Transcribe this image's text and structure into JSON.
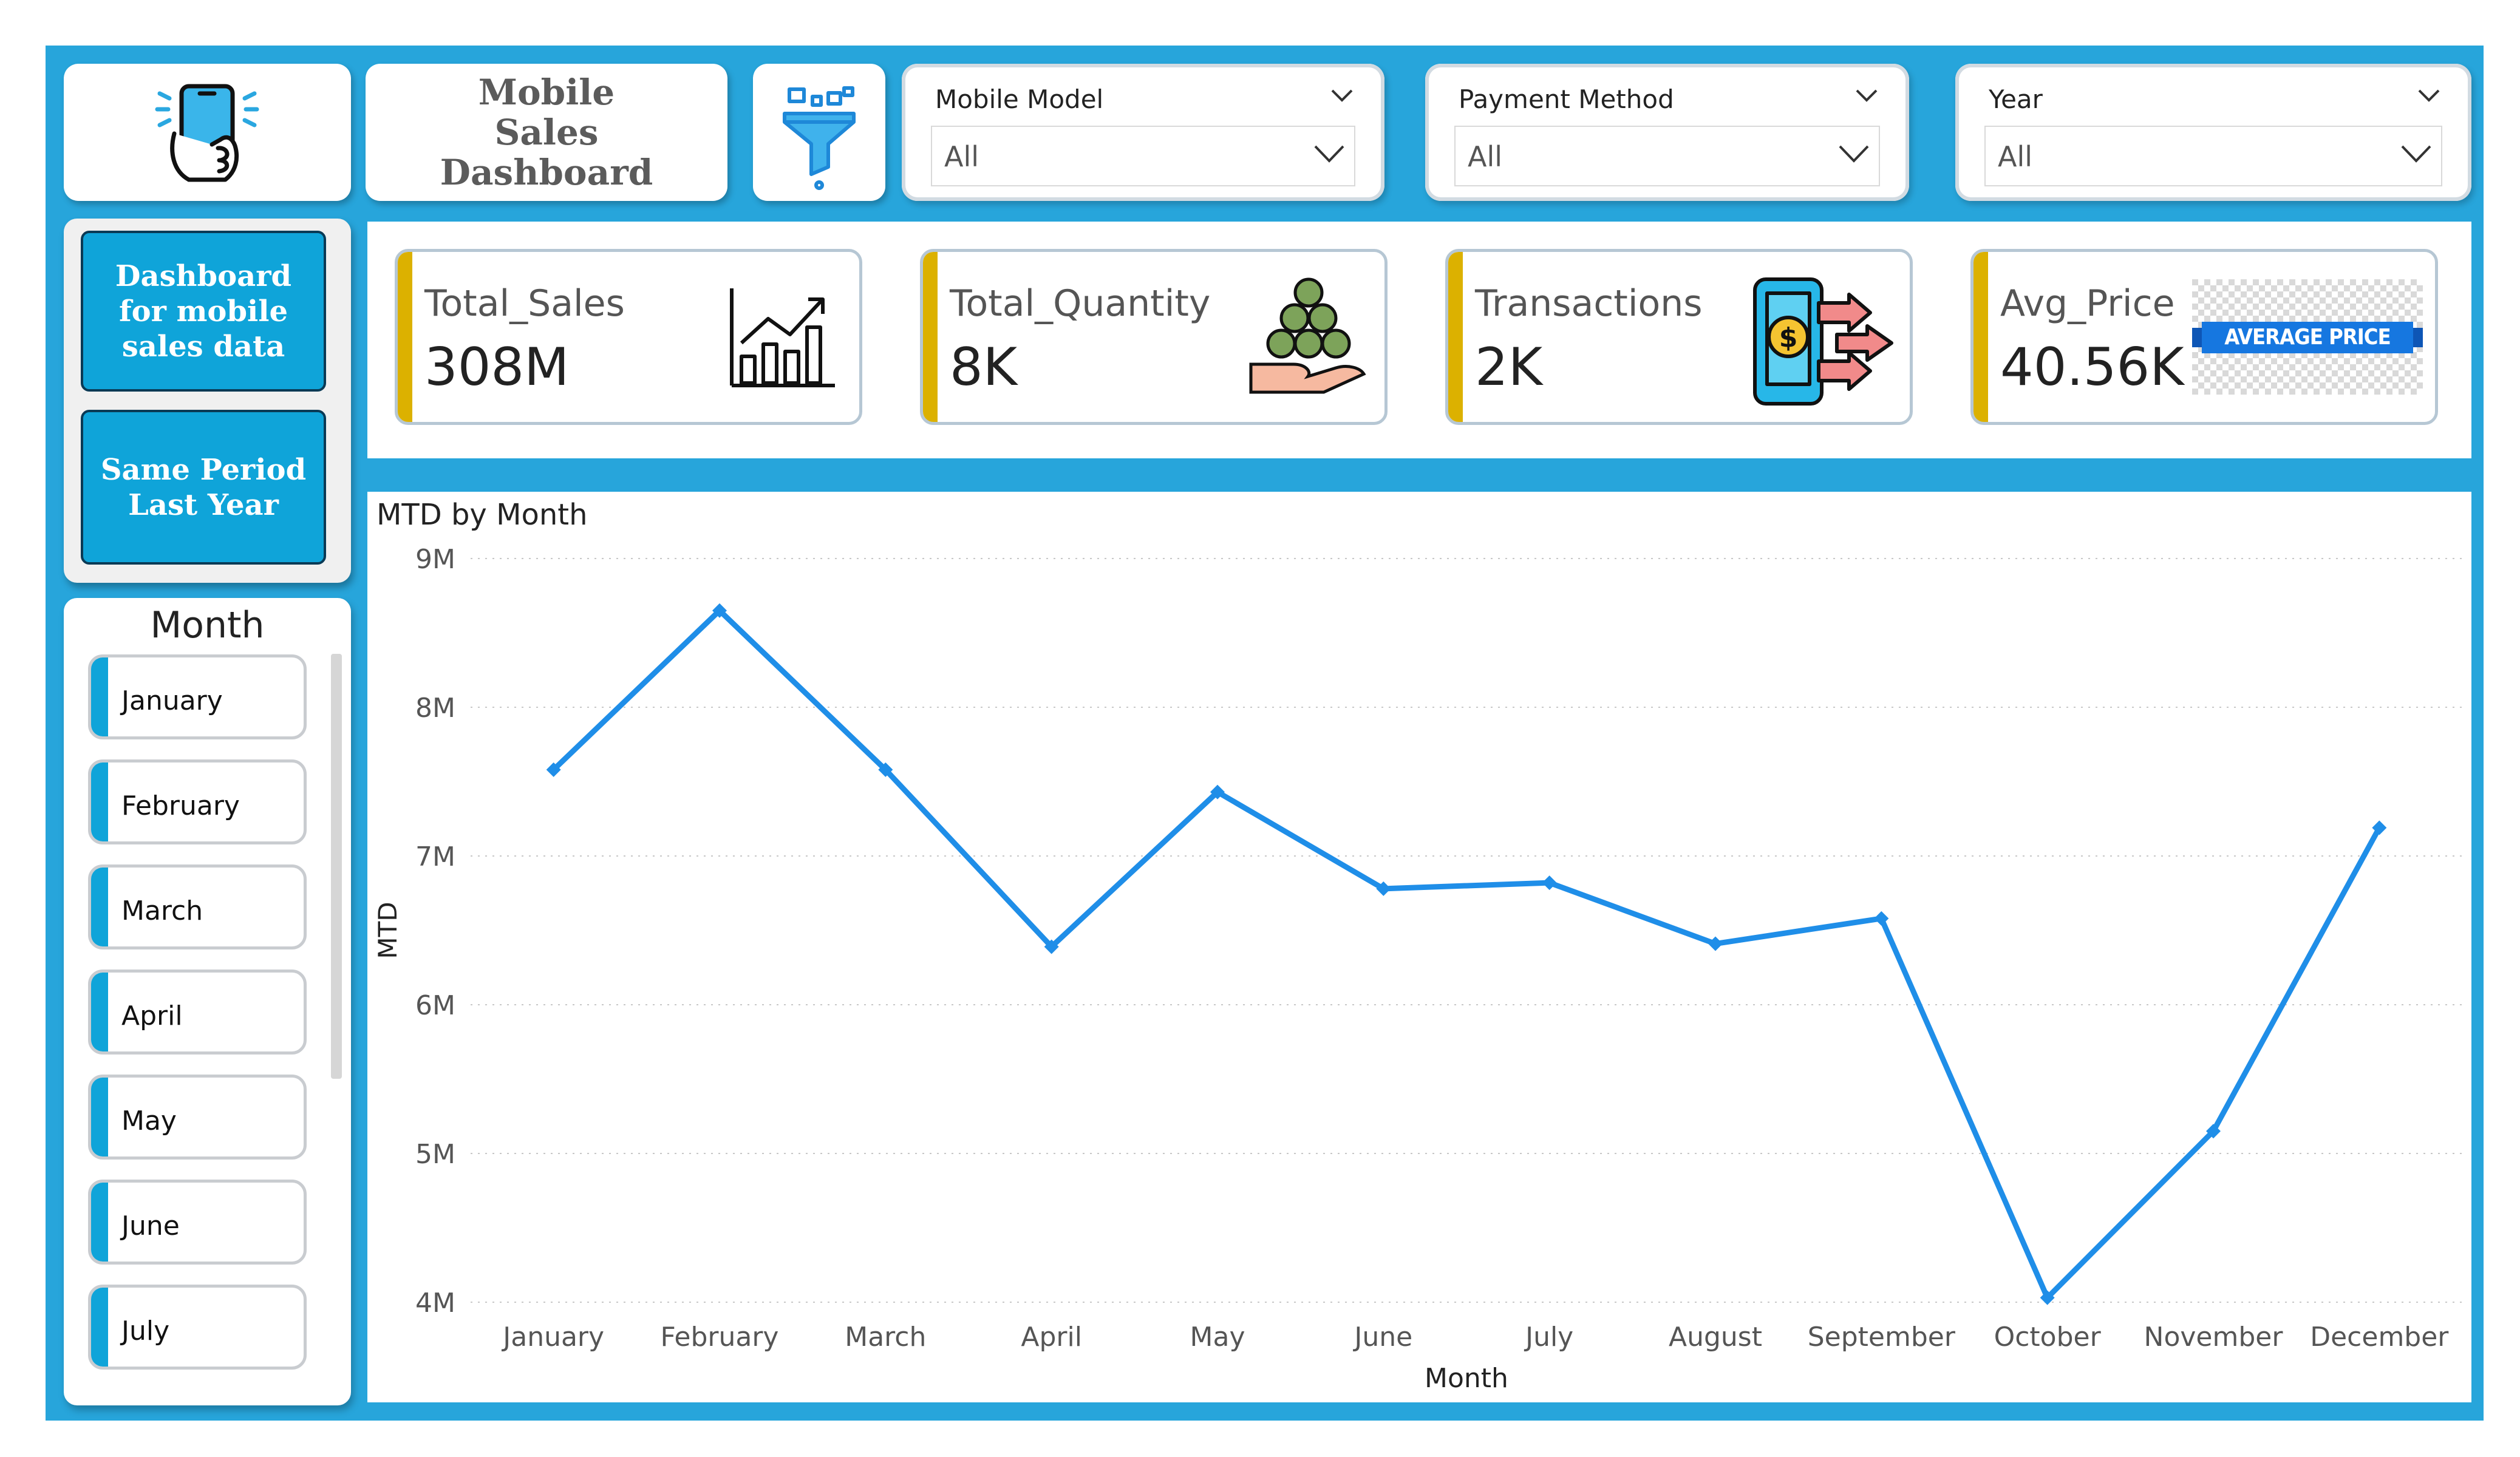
{
  "header": {
    "title": "Mobile Sales Dashboard",
    "logo_icon": "phone-in-hand-icon",
    "filter_icon": "funnel-filter-icon"
  },
  "slicers": [
    {
      "label": "Mobile Model",
      "value": "All"
    },
    {
      "label": "Payment Method",
      "value": "All"
    },
    {
      "label": "Year",
      "value": "All"
    }
  ],
  "nav": {
    "dashboard_button": "Dashboard for mobile sales data",
    "same_period_button": "Same Period Last Year"
  },
  "kpis": [
    {
      "name": "Total_Sales",
      "value": "308M",
      "icon": "growth-chart-icon"
    },
    {
      "name": "Total_Quantity",
      "value": "8K",
      "icon": "coins-in-hand-icon"
    },
    {
      "name": "Transactions",
      "value": "2K",
      "icon": "phone-payment-icon"
    },
    {
      "name": "Avg_Price",
      "value": "40.56K",
      "icon": "average-price-badge-icon",
      "badge_text": "AVERAGE PRICE"
    }
  ],
  "month_slicer": {
    "title": "Month",
    "items": [
      "January",
      "February",
      "March",
      "April",
      "May",
      "June",
      "July"
    ]
  },
  "colors": {
    "frame": "#27a5db",
    "accent_kpi": "#dcb100",
    "line": "#1f8ee8",
    "nav_button": "#0fa4d9"
  },
  "chart_data": {
    "type": "line",
    "title": "MTD by Month",
    "xlabel": "Month",
    "ylabel": "MTD",
    "categories": [
      "January",
      "February",
      "March",
      "April",
      "May",
      "June",
      "July",
      "August",
      "September",
      "October",
      "November",
      "December"
    ],
    "values": [
      7.58,
      8.65,
      7.58,
      6.39,
      7.43,
      6.78,
      6.82,
      6.41,
      6.58,
      4.03,
      5.15,
      7.19
    ],
    "ylim": [
      4,
      9
    ],
    "yticks": [
      {
        "v": 9,
        "label": "9M"
      },
      {
        "v": 8,
        "label": "8M"
      },
      {
        "v": 7,
        "label": "7M"
      },
      {
        "v": 6,
        "label": "6M"
      },
      {
        "v": 5,
        "label": "5M"
      },
      {
        "v": 4,
        "label": "4M"
      }
    ],
    "grid": true
  }
}
